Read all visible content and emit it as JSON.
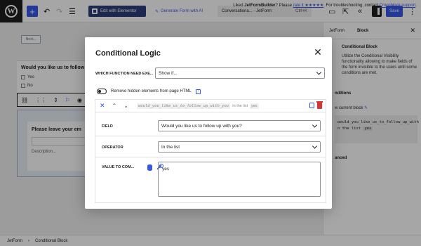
{
  "topbar": {
    "elementor_label": "Edit with Elementor",
    "genai_label": "Generate Form with AI",
    "doc_title": "Conversationa... · JetForm",
    "doc_shortcut": "Ctrl+K",
    "save_label": "Save"
  },
  "canvas": {
    "next_label": "Next...",
    "question": "Would you like us to follow up",
    "options": [
      "Yes",
      "No"
    ],
    "leave_title": "Please leave your em",
    "leave_desc": "Description..."
  },
  "sidebar": {
    "tabs": [
      "JetForm",
      "Block"
    ],
    "block_title": "Conditional Block",
    "block_desc": "Utilize the Conditional Visibility functionality allowing to make fields of the form invisible to the users until some conditions are met.",
    "conditions_label": "nditions",
    "current_block_label": "w current block",
    "code_line1": "would_you_like_us_to_follow_up_with",
    "code_line2_prefix": "n the list",
    "code_line2_val": "yes",
    "advanced_label": "anced"
  },
  "footer": {
    "crumb1": "JetForm",
    "sep": "›",
    "crumb2": "Conditional Block",
    "liked_prefix": "Liked ",
    "liked_brand": "JetFormBuilder",
    "liked_mid": "? Please ",
    "rate_link": "rate it ★★★★★",
    "tail": ". For troubleshooting, contact ",
    "support_link": "Crocoblock support",
    "end": "."
  },
  "modal": {
    "title": "Conditional Logic",
    "which_label": "WHICH FUNCTION NEED EXE...",
    "which_value": "Show if...",
    "toggle_label": "Remove hidden elements from page HTML",
    "summary_field": "would_you_like_us_to_follow_up_with_you",
    "summary_op": "In the list",
    "summary_val": "yes",
    "field_label": "FIELD",
    "field_value": "Would you like us to follow up with you?",
    "operator_label": "OPERATOR",
    "operator_value": "In the list",
    "value_label": "VALUE TO COM...",
    "value_text": "yes"
  },
  "colors": {
    "accent": "#3858e9",
    "danger": "#d63638",
    "elementor": "#2c3e7a"
  }
}
